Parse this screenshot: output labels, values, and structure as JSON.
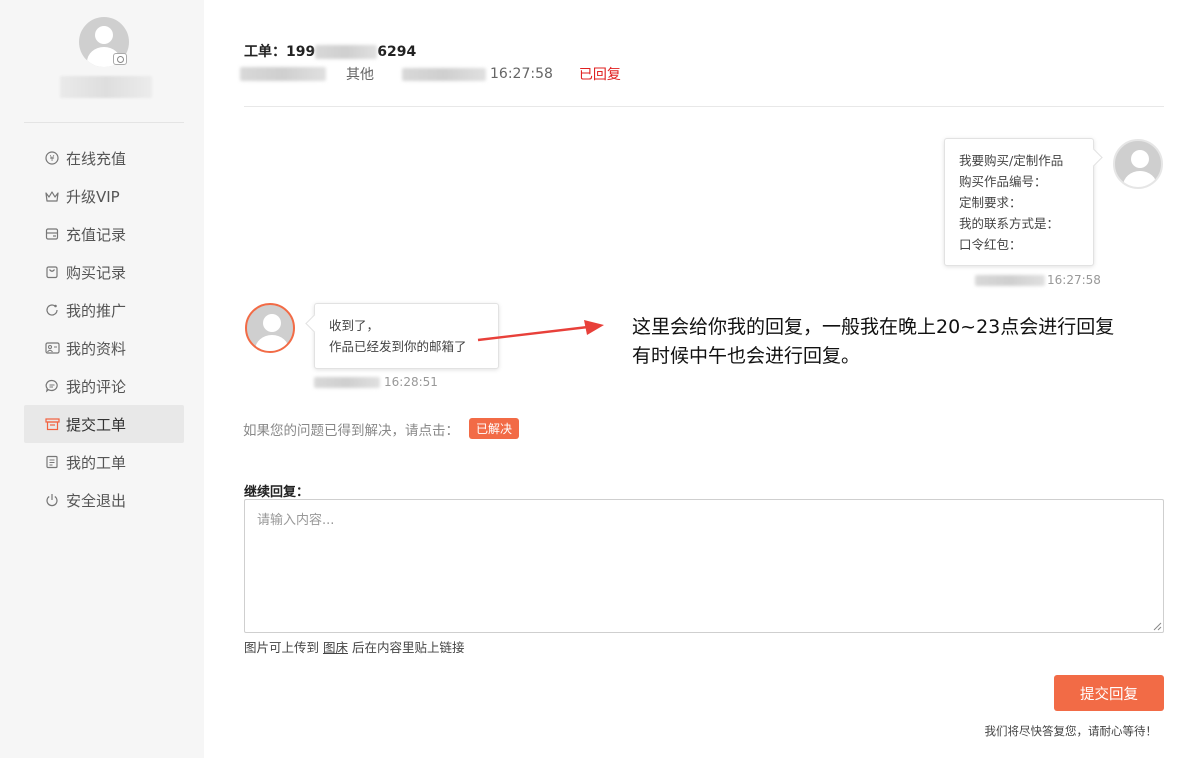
{
  "sidebar": {
    "items": [
      {
        "icon": "yen-circle-icon",
        "label": "在线充值"
      },
      {
        "icon": "crown-icon",
        "label": "升级VIP"
      },
      {
        "icon": "wallet-icon",
        "label": "充值记录"
      },
      {
        "icon": "shopping-bag-icon",
        "label": "购买记录"
      },
      {
        "icon": "share-icon",
        "label": "我的推广"
      },
      {
        "icon": "profile-card-icon",
        "label": "我的资料"
      },
      {
        "icon": "comment-icon",
        "label": "我的评论"
      },
      {
        "icon": "ticket-icon",
        "label": "提交工单",
        "active": true
      },
      {
        "icon": "document-icon",
        "label": "我的工单"
      },
      {
        "icon": "power-icon",
        "label": "安全退出"
      }
    ]
  },
  "ticket": {
    "title_prefix": "工单：",
    "id_visible_start": "199",
    "id_visible_end": "6294",
    "category": "其他",
    "time_visible": "16:27:58",
    "status": "已回复"
  },
  "messages": {
    "user": {
      "lines": [
        "我要购买/定制作品",
        "购买作品编号：",
        "定制要求：",
        "我的联系方式是：",
        "口令红包："
      ],
      "time_visible": "16:27:58"
    },
    "admin": {
      "lines": [
        "收到了，",
        "作品已经发到你的邮箱了"
      ],
      "time_visible": "16:28:51"
    }
  },
  "annotation": {
    "line1": "这里会给你我的回复，一般我在晚上20~23点会进行回复",
    "line2": "有时候中午也会进行回复。",
    "arrow_color": "#e8403a"
  },
  "resolve": {
    "text": "如果您的问题已得到解决，请点击：",
    "button": "已解决"
  },
  "reply": {
    "label": "继续回复：",
    "placeholder": "请输入内容...",
    "hint_before": "图片可上传到 ",
    "hint_link": "图床",
    "hint_after": " 后在内容里贴上链接",
    "submit": "提交回复",
    "footer": "我们将尽快答复您，请耐心等待！"
  },
  "colors": {
    "accent": "#f26b46",
    "status_red": "#e02020",
    "sidebar_bg": "#f6f6f6"
  }
}
